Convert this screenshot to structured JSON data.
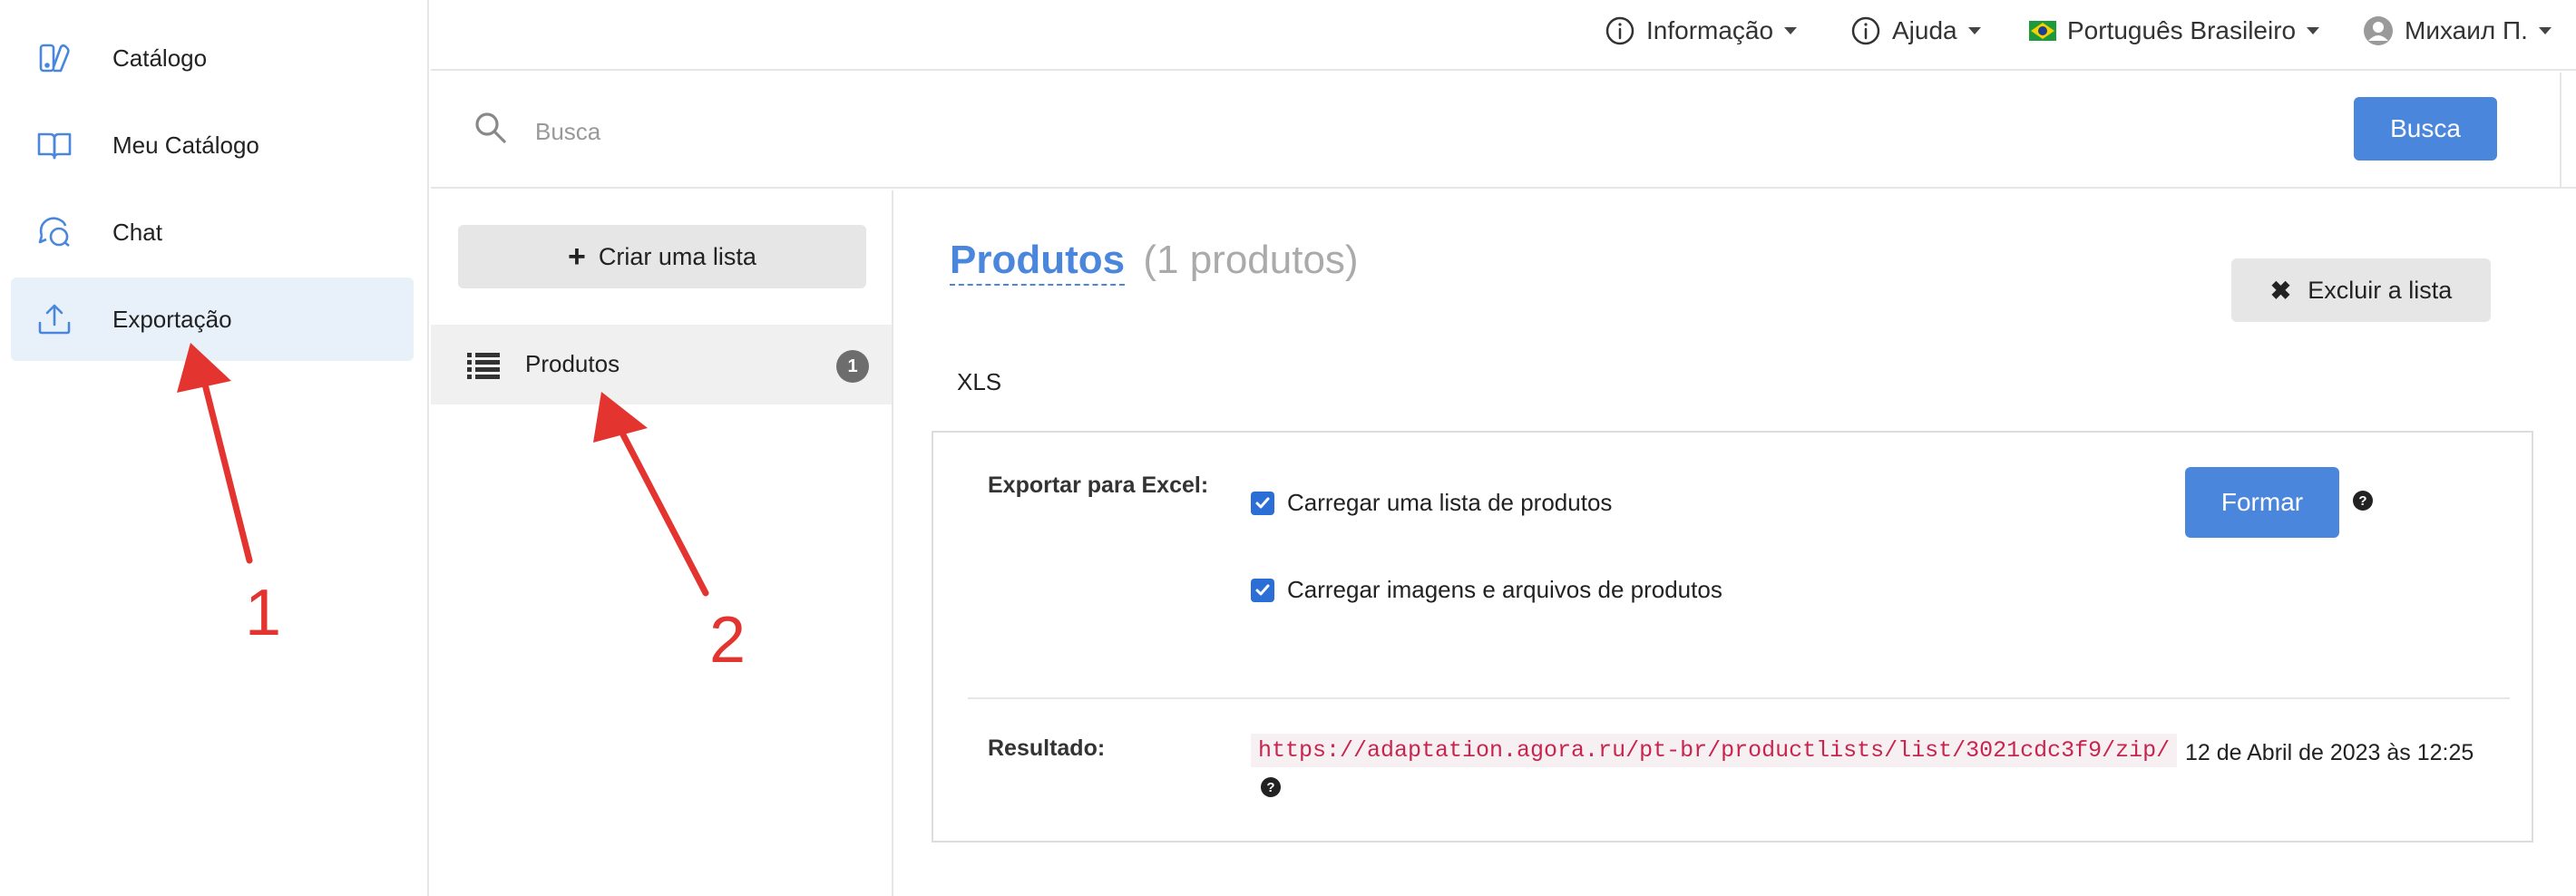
{
  "sidebar": {
    "items": [
      {
        "label": "Catálogo",
        "icon": "catalog-icon",
        "active": false
      },
      {
        "label": "Meu Catálogo",
        "icon": "book-icon",
        "active": false
      },
      {
        "label": "Chat",
        "icon": "chat-icon",
        "active": false
      },
      {
        "label": "Exportação",
        "icon": "upload-icon",
        "active": true
      }
    ]
  },
  "topbar": {
    "info": "Informação",
    "help": "Ajuda",
    "language": "Português Brasileiro",
    "user": "Михаил П."
  },
  "search": {
    "placeholder": "Busca",
    "button": "Busca"
  },
  "lists": {
    "create_button": "Criar uma lista",
    "items": [
      {
        "label": "Produtos",
        "count": "1"
      }
    ]
  },
  "main": {
    "title": "Produtos",
    "count_text": "(1 produtos)",
    "delete_button": "Excluir a lista",
    "tab": "XLS",
    "export_label": "Exportar para Excel:",
    "option_1": "Carregar uma lista de produtos",
    "option_2": "Carregar imagens e arquivos de produtos",
    "form_button": "Formar",
    "help_glyph": "?",
    "result_label": "Resultado:",
    "result_link": "https://adaptation.agora.ru/pt-br/productlists/list/3021cdc3f9/zip/",
    "result_date": "12 de Abril de 2023 às 12:25"
  },
  "annotations": {
    "marker_1": "1",
    "marker_2": "2",
    "color": "#e3342f"
  },
  "colors": {
    "accent": "#4a87dc",
    "active_bg": "#e8f0fa",
    "link": "#c7254e"
  }
}
